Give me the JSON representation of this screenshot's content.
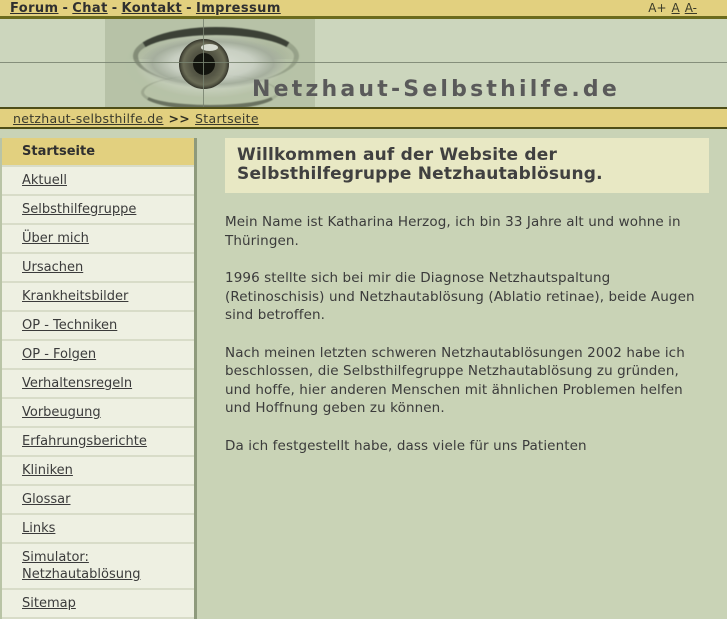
{
  "topbar": {
    "links": [
      {
        "label": "Forum"
      },
      {
        "label": "Chat"
      },
      {
        "label": "Kontakt"
      },
      {
        "label": "Impressum"
      }
    ],
    "separator": "-",
    "fontsize": {
      "increase": "A+",
      "normal": "A",
      "decrease": "A-"
    }
  },
  "banner": {
    "title": "Netzhaut-Selbsthilfe.de",
    "image_name": "eye-photo"
  },
  "breadcrumb": {
    "home": "netzhaut-selbsthilfe.de",
    "separator": ">>",
    "current": "Startseite"
  },
  "sidebar": {
    "items": [
      {
        "label": "Startseite",
        "active": true
      },
      {
        "label": "Aktuell",
        "active": false
      },
      {
        "label": "Selbsthilfegruppe",
        "active": false
      },
      {
        "label": "Über mich",
        "active": false
      },
      {
        "label": "Ursachen",
        "active": false
      },
      {
        "label": "Krankheitsbilder",
        "active": false
      },
      {
        "label": "OP - Techniken",
        "active": false
      },
      {
        "label": "OP - Folgen",
        "active": false
      },
      {
        "label": "Verhaltensregeln",
        "active": false
      },
      {
        "label": "Vorbeugung",
        "active": false
      },
      {
        "label": "Erfahrungsberichte",
        "active": false
      },
      {
        "label": "Kliniken",
        "active": false
      },
      {
        "label": "Glossar",
        "active": false
      },
      {
        "label": "Links",
        "active": false
      },
      {
        "label": "Simulator: Netzhautablösung",
        "active": false
      },
      {
        "label": "Sitemap",
        "active": false
      }
    ]
  },
  "main": {
    "heading": "Willkommen auf der Website der Selbsthilfegruppe Netzhautablösung.",
    "paragraphs": [
      "Mein Name ist Katharina Herzog, ich bin 33 Jahre alt und wohne in\nThüringen.",
      "1996 stellte sich bei mir die Diagnose Netzhautspaltung (Retinoschisis) und Netzhautablösung (Ablatio retinae), beide Augen sind betroffen.",
      "Nach meinen letzten schweren Netzhautablösungen 2002 habe ich beschlossen, die Selbsthilfegruppe Netzhautablösung zu gründen, und hoffe, hier anderen Menschen mit ähnlichen Problemen helfen und Hoffnung geben zu können.",
      "Da ich festgestellt habe, dass viele für uns Patienten"
    ]
  },
  "colors": {
    "accent_gold": "#e2d07f",
    "page_bg": "#c9d3b6",
    "nav_bg": "#eef0e2",
    "heading_box": "#e8e8c4",
    "rule_dark": "#4e4e18"
  }
}
